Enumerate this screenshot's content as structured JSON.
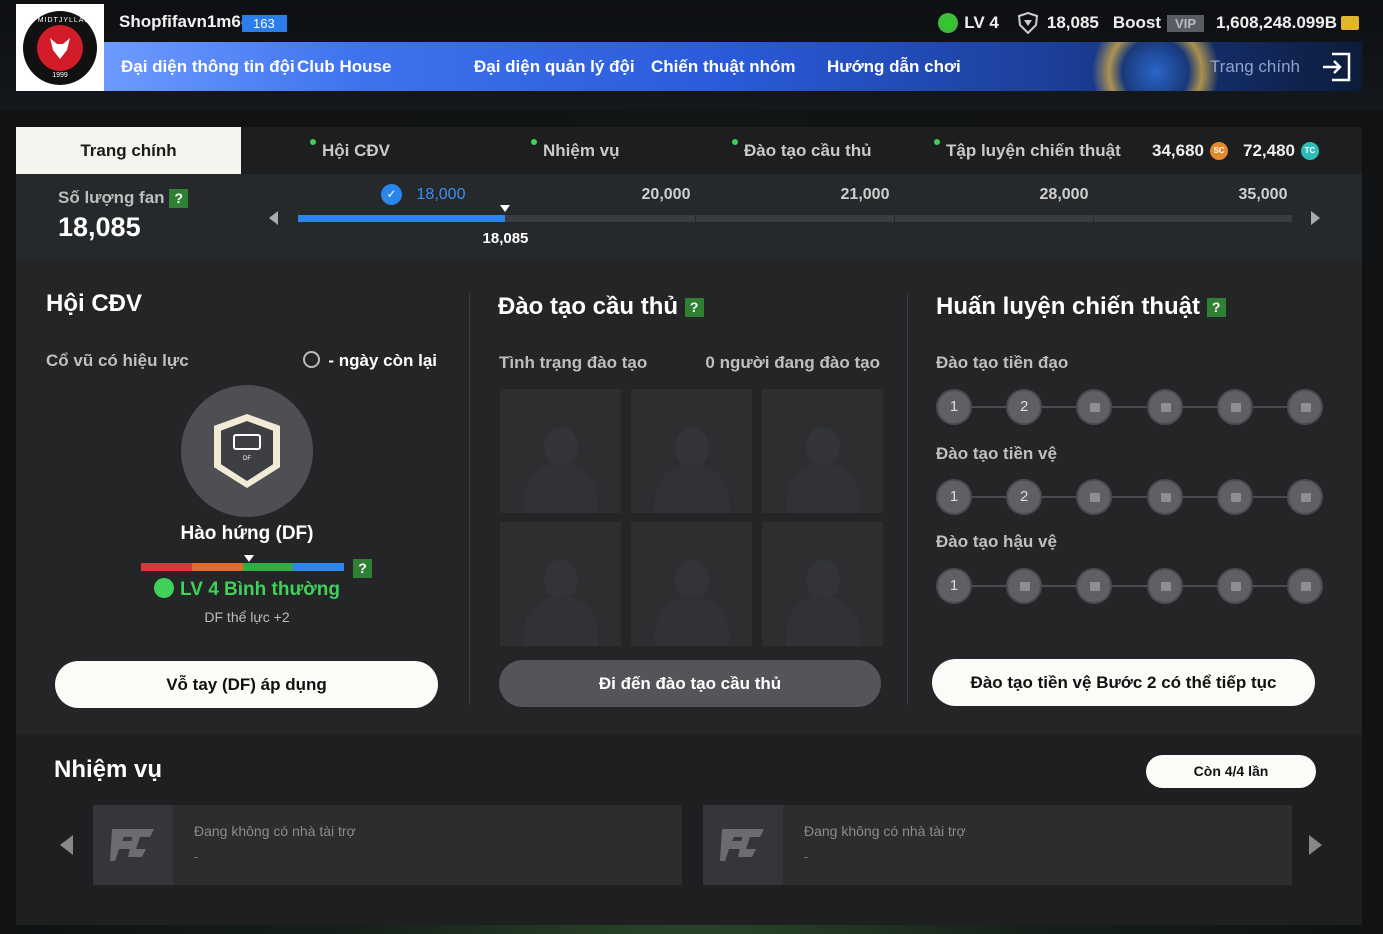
{
  "header": {
    "club_logo_text": "FC MIDTJYLLAND",
    "club_logo_year": "1999",
    "username": "Shopfifavn1m6c",
    "user_level": "163",
    "level": "LV 4",
    "fans": "18,085",
    "boost_label": "Boost",
    "vip_label": "VIP",
    "balance": "1,608,248.099B"
  },
  "nav": {
    "items": [
      {
        "label": "Đại diện thông tin đội"
      },
      {
        "label": "Club House"
      },
      {
        "label": "Đại diện quản lý đội"
      },
      {
        "label": "Chiến thuật nhóm"
      },
      {
        "label": "Hướng dẫn chơi"
      }
    ],
    "home_label": "Trang chính"
  },
  "tabs": {
    "items": [
      {
        "label": "Trang chính"
      },
      {
        "label": "Hội CĐV"
      },
      {
        "label": "Nhiệm vụ"
      },
      {
        "label": "Đào tạo cầu thủ"
      },
      {
        "label": "Tập luyện chiến thuật"
      }
    ],
    "sc_amount": "34,680",
    "tc_amount": "72,480",
    "sc_icon_text": "SC",
    "tc_icon_text": "TC"
  },
  "fans": {
    "label": "Số lượng fan",
    "help": "?",
    "value": "18,085",
    "current_value": 18085,
    "current_label": "18,085",
    "milestones": [
      {
        "label": "18,000",
        "value": 18000,
        "reached": true
      },
      {
        "label": "20,000",
        "value": 20000,
        "reached": false
      },
      {
        "label": "21,000",
        "value": 21000,
        "reached": false
      },
      {
        "label": "28,000",
        "value": 28000,
        "reached": false
      },
      {
        "label": "35,000",
        "value": 35000,
        "reached": false
      }
    ]
  },
  "supporters": {
    "title": "Hội CĐV",
    "effect_label": "Cổ vũ có hiệu lực",
    "days_left": "- ngày còn lại",
    "badge_pos": "DF",
    "cheer_name": "Hào hứng (DF)",
    "mood_colors": [
      "#e2323b",
      "#e36c2c",
      "#2fae48",
      "#2a86ea"
    ],
    "mood_level": 0.53,
    "mood_label": "LV 4 Bình thường",
    "mood_effect": "DF thể lực +2",
    "help": "?",
    "button": "Vỗ tay (DF) áp dụng"
  },
  "training": {
    "title": "Đào tạo cầu thủ",
    "help": "?",
    "status_label": "Tình trạng đào tạo",
    "status_value": "0 người đang đào tạo",
    "button": "Đi đến đào tạo cầu thủ"
  },
  "tactics": {
    "title": "Huấn luyện chiến thuật",
    "help": "?",
    "rows": [
      {
        "label": "Đào tạo tiền đạo",
        "nodes": [
          "1",
          "2",
          "",
          "",
          "",
          ""
        ]
      },
      {
        "label": "Đào tạo tiền vệ",
        "nodes": [
          "1",
          "2",
          "",
          "",
          "",
          ""
        ]
      },
      {
        "label": "Đào tạo hậu vệ",
        "nodes": [
          "1",
          "",
          "",
          "",
          "",
          ""
        ]
      }
    ],
    "button": "Đào tạo tiền vệ Bước 2 có thể tiếp tục"
  },
  "missions": {
    "title": "Nhiệm vụ",
    "remaining": "Còn 4/4 lần",
    "cards": [
      {
        "name": "Đang không có nhà tài trợ",
        "detail": "-"
      },
      {
        "name": "Đang không có nhà tài trợ",
        "detail": "-"
      }
    ]
  }
}
